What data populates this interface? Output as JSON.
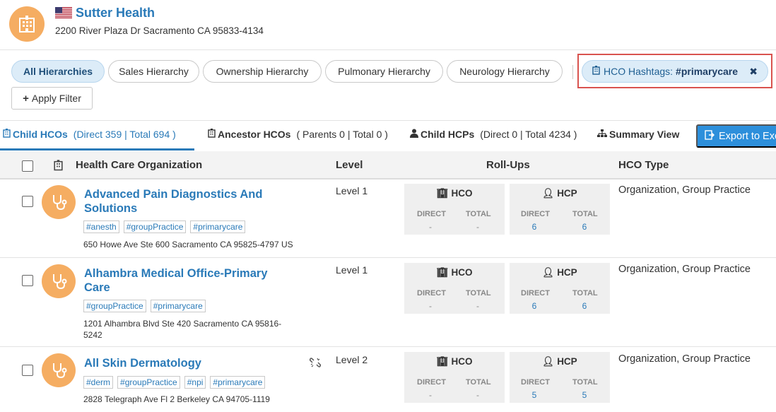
{
  "header": {
    "org_name": "Sutter Health",
    "org_address": "2200 River Plaza Dr Sacramento CA 95833-4134"
  },
  "filters": {
    "hierarchies": [
      "All Hierarchies",
      "Sales Hierarchy",
      "Ownership Hierarchy",
      "Pulmonary Hierarchy",
      "Neurology Hierarchy"
    ],
    "hashtag_label": "HCO Hashtags:",
    "hashtag_value": "#primarycare",
    "apply_filter": "Apply Filter"
  },
  "tabs": {
    "child_hcos": {
      "label": "Child HCOs",
      "detail": "(Direct 359 | Total 694 )"
    },
    "ancestor_hcos": {
      "label": "Ancestor HCOs",
      "detail": "( Parents 0 | Total 0 )"
    },
    "child_hcps": {
      "label": "Child HCPs",
      "detail": "(Direct 0 | Total 4234 )"
    },
    "summary_view": {
      "label": "Summary View"
    },
    "export": "Export to Excel"
  },
  "table": {
    "headers": {
      "org": "Health Care Organization",
      "level": "Level",
      "rollups": "Roll-Ups",
      "hco_type": "HCO Type"
    },
    "rollup_labels": {
      "hco": "HCO",
      "hcp": "HCP",
      "direct": "DIRECT",
      "total": "TOTAL"
    },
    "rows": [
      {
        "name_line1": "Advanced Pain Diagnostics And",
        "name_line2": "Solutions",
        "tags": [
          "#anesth",
          "#groupPractice",
          "#primarycare"
        ],
        "address_line1": "650 Howe Ave Ste 600 Sacramento CA 95825-4797 US",
        "address_line2": "",
        "level": "Level 1",
        "hco_direct": "-",
        "hco_total": "-",
        "hcp_direct": "6",
        "hcp_total": "6",
        "type": "Organization, Group Practice"
      },
      {
        "name_line1": "Alhambra Medical Office-Primary",
        "name_line2": "Care",
        "tags": [
          "#groupPractice",
          "#primarycare"
        ],
        "address_line1": "1201 Alhambra Blvd Ste 420 Sacramento CA 95816-",
        "address_line2": "5242",
        "level": "Level 1",
        "hco_direct": "-",
        "hco_total": "-",
        "hcp_direct": "6",
        "hcp_total": "6",
        "type": "Organization, Group Practice"
      },
      {
        "name_line1": "All Skin Dermatology",
        "name_line2": "",
        "tags": [
          "#derm",
          "#groupPractice",
          "#npi",
          "#primarycare"
        ],
        "address_line1": "2828 Telegraph Ave Fl 2 Berkeley CA 94705-1119",
        "address_line2": "",
        "level": "Level 2",
        "hco_direct": "-",
        "hco_total": "-",
        "hcp_direct": "5",
        "hcp_total": "5",
        "type": "Organization, Group Practice"
      }
    ]
  },
  "colors": {
    "accent": "#2a7ab8",
    "avatar": "#f5ad62",
    "export_button": "#2d8fdb",
    "highlight_border": "#d9534f"
  }
}
